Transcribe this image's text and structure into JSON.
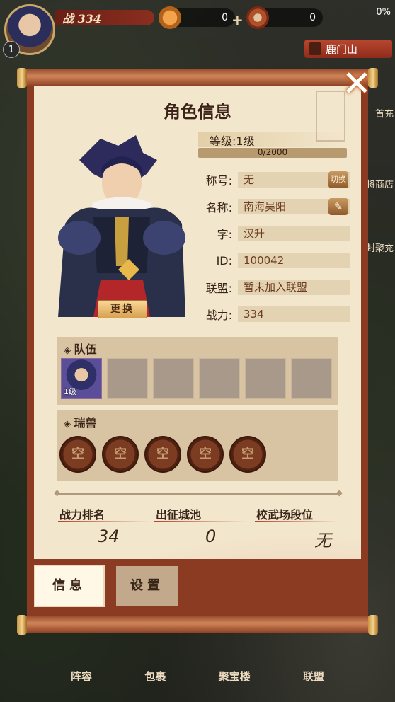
{
  "hud": {
    "player_level": "1",
    "power": "战 334",
    "ingot_count": "0",
    "coin_count": "0",
    "battery": "0%",
    "location": "鹿门山"
  },
  "side_labels": [
    "首充",
    "将商店",
    "封聚充"
  ],
  "bottom_nav": [
    "阵容",
    "包裹",
    "聚宝楼",
    "联盟"
  ],
  "dialog": {
    "title": "角色信息",
    "close_icon": "close-icon",
    "change_button": "更换",
    "level_label": "等级:1级",
    "exp": {
      "current": 0,
      "max": 2000,
      "text": "0/2000"
    },
    "fields": [
      {
        "label": "称号:",
        "value": "无",
        "button": "切换"
      },
      {
        "label": "名称:",
        "value": "南海吴阳",
        "button_icon": "pencil-icon"
      },
      {
        "label": "字:",
        "value": "汉升"
      },
      {
        "label": "ID:",
        "value": "100042"
      },
      {
        "label": "联盟:",
        "value": "暂未加入联盟"
      },
      {
        "label": "战力:",
        "value": "334"
      }
    ],
    "team": {
      "title": "队伍",
      "slots": [
        {
          "level": "1级"
        },
        {},
        {},
        {},
        {},
        {}
      ]
    },
    "beasts": {
      "title": "瑞兽",
      "slots": [
        "空",
        "空",
        "空",
        "空",
        "空"
      ]
    },
    "stats": [
      {
        "title": "战力排名",
        "value": "34"
      },
      {
        "title": "出征城池",
        "value": "0"
      },
      {
        "title": "校武场段位",
        "value": "无"
      }
    ],
    "tabs": {
      "info": "信息",
      "settings": "设置"
    }
  },
  "colors": {
    "scroll_rod": "#c47a4e",
    "paper": "#f2e6cc",
    "panel": "#d8c3a2",
    "accent_red": "#b8402a"
  }
}
